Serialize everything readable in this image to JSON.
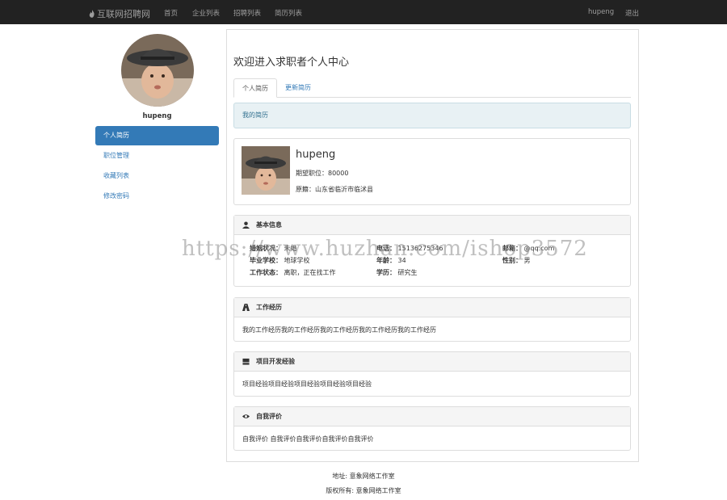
{
  "navbar": {
    "brand": "互联网招聘网",
    "links": [
      "首页",
      "企业列表",
      "招聘列表",
      "简历列表"
    ],
    "username": "hupeng",
    "logout": "退出"
  },
  "sidebar": {
    "username": "hupeng",
    "items": [
      {
        "label": "个人简历",
        "active": true
      },
      {
        "label": "职位管理",
        "active": false
      },
      {
        "label": "收藏列表",
        "active": false
      },
      {
        "label": "修改密码",
        "active": false
      }
    ]
  },
  "main": {
    "welcome": "欢迎进入求职者个人中心",
    "tabs": [
      "个人简历",
      "更新简历"
    ],
    "alert": "我的简历",
    "profile": {
      "name": "hupeng",
      "job_line": "期望职位：80000",
      "origin_line": "原籍：山东省临沂市临沭县"
    },
    "basic": {
      "title": "基本信息",
      "fields": [
        {
          "k": "婚姻状况：",
          "v": "未婚"
        },
        {
          "k": "毕业学校：",
          "v": "地球学校"
        },
        {
          "k": "工作状态：",
          "v": "离职，正在找工作"
        },
        {
          "k": "电话：",
          "v": "15136275346"
        },
        {
          "k": "年龄：",
          "v": "34"
        },
        {
          "k": "学历：",
          "v": "研究生"
        },
        {
          "k": "邮箱：",
          "v": "@qq.com"
        },
        {
          "k": "性别：",
          "v": "男"
        }
      ]
    },
    "work": {
      "title": "工作经历",
      "text": "我的工作经历我的工作经历我的工作经历我的工作经历我的工作经历"
    },
    "project": {
      "title": "项目开发经验",
      "text": "项目经验项目经验项目经验项目经验项目经验"
    },
    "self": {
      "title": "自我评价",
      "text": "自我评价 自我评价自我评价自我评价自我评价"
    }
  },
  "watermark": "https://www.huzhan.com/ishop3572",
  "footer": {
    "address": "地址: 意象网络工作室",
    "copyright": "版权所有: 意象网络工作室"
  }
}
